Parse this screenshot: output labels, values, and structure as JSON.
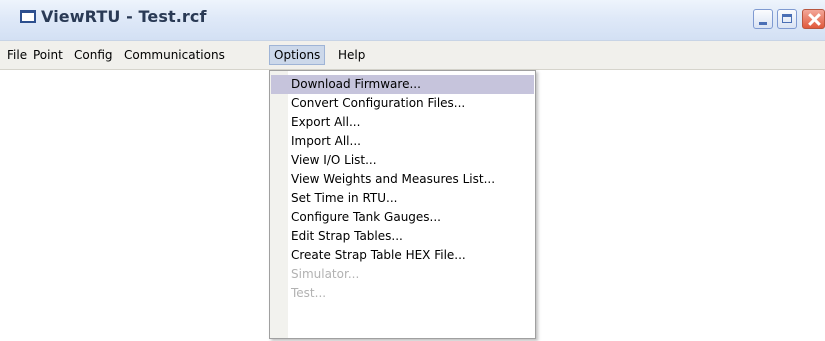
{
  "window": {
    "title": "ViewRTU - Test.rcf"
  },
  "menubar": {
    "items": [
      "File",
      "Point",
      "Config",
      "Communications",
      "Options",
      "Help"
    ],
    "active": "Options"
  },
  "options_menu": {
    "items": [
      {
        "label": "Download Firmware...",
        "state": "highlighted"
      },
      {
        "label": "Convert Configuration Files...",
        "state": "enabled"
      },
      {
        "label": "Export All...",
        "state": "enabled"
      },
      {
        "label": "Import All...",
        "state": "enabled"
      },
      {
        "label": "View I/O List...",
        "state": "enabled"
      },
      {
        "label": "View Weights and Measures List...",
        "state": "enabled"
      },
      {
        "label": "Set Time in RTU...",
        "state": "enabled"
      },
      {
        "label": "Configure Tank Gauges...",
        "state": "enabled"
      },
      {
        "label": "Edit Strap Tables...",
        "state": "enabled"
      },
      {
        "label": "Create Strap Table HEX File...",
        "state": "enabled"
      },
      {
        "label": "Simulator...",
        "state": "disabled"
      },
      {
        "label": "Test...",
        "state": "disabled"
      }
    ]
  },
  "icons": {
    "app": "window-icon",
    "minimize": "minimize-icon",
    "maximize": "maximize-icon",
    "close": "close-icon"
  },
  "colors": {
    "menu_highlight": "#c6c4dc",
    "active_menu": "#ccd8ea",
    "disabled_text": "#b2b2b2",
    "close_button": "#e1593c"
  }
}
